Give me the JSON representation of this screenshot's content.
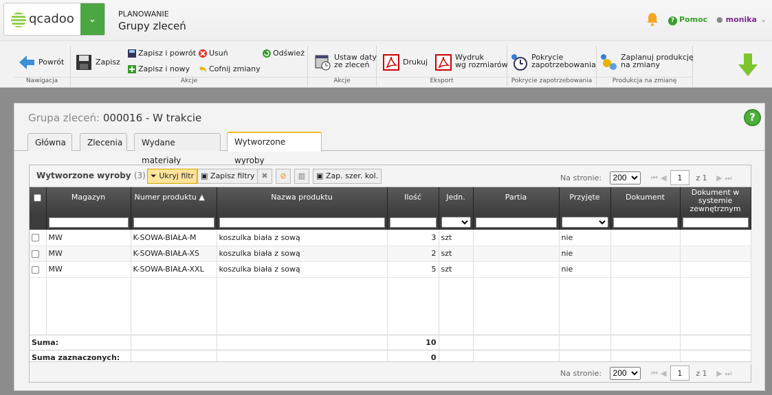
{
  "app": {
    "logo_text": "qcadoo",
    "module": "PLANOWANIE",
    "page": "Grupy zleceń"
  },
  "topnav": {
    "help": "Pomoc",
    "user": "monika"
  },
  "ribbon": {
    "groups": [
      "Nawigacja",
      "Akcje",
      "Akcje",
      "Eksport",
      "Pokrycie zapotrzebowania",
      "Produkcja na zmianę"
    ],
    "back": "Powrót",
    "save": "Zapisz",
    "save_back": "Zapisz i powrót",
    "save_new": "Zapisz i nowy",
    "delete": "Usuń",
    "undo": "Cofnij zmiany",
    "refresh": "Odśwież",
    "set_dates_1": "Ustaw daty",
    "set_dates_2": "ze zleceń",
    "print": "Drukuj",
    "print_sizes_1": "Wydruk",
    "print_sizes_2": "wg rozmiarów",
    "coverage_1": "Pokrycie",
    "coverage_2": "zapotrzebowania",
    "plan_1": "Zaplanuj produkcję",
    "plan_2": "na zmiany"
  },
  "panel": {
    "label": "Grupa zleceń:",
    "value": "000016 - W trakcie"
  },
  "tabs": [
    {
      "label": "Główna"
    },
    {
      "label": "Zlecenia"
    },
    {
      "label": "Wydane materiały"
    },
    {
      "label": "Wytworzone wyroby"
    }
  ],
  "grid": {
    "title": "Wytworzone wyroby",
    "count": "(3)",
    "buttons": {
      "hide_filter": "Ukryj filtr",
      "save_filters": "Zapisz filtry",
      "save_widths": "Zap. szer. kol."
    },
    "pager": {
      "label": "Na stronie:",
      "per_page": "200",
      "page": "1",
      "of": "z 1"
    },
    "columns": [
      "Magazyn",
      "Numer produktu",
      "Nazwa produktu",
      "Ilość",
      "Jedn.",
      "Partia",
      "Przyjęte",
      "Dokument",
      "Dokument w systemie zewnętrznym"
    ],
    "rows": [
      {
        "magazyn": "MW",
        "numer": "K-SOWA-BIAŁA-M",
        "nazwa": "koszulka biała z sową",
        "ilosc": "3",
        "jedn": "szt",
        "partia": "",
        "przyjete": "nie",
        "dokument": "",
        "dok_zew": ""
      },
      {
        "magazyn": "MW",
        "numer": "K-SOWA-BIAŁA-XS",
        "nazwa": "koszulka biała z sową",
        "ilosc": "2",
        "jedn": "szt",
        "partia": "",
        "przyjete": "nie",
        "dokument": "",
        "dok_zew": ""
      },
      {
        "magazyn": "MW",
        "numer": "K-SOWA-BIAŁA-XXL",
        "nazwa": "koszulka biała z sową",
        "ilosc": "5",
        "jedn": "szt",
        "partia": "",
        "przyjete": "nie",
        "dokument": "",
        "dok_zew": ""
      }
    ],
    "sum_label": "Suma:",
    "sum_value": "10",
    "sum_selected_label": "Suma zaznaczonych:",
    "sum_selected_value": "0"
  },
  "colors": {
    "accent_green": "#4aa742",
    "active_tab": "#f0c020",
    "filter_on": "#ffe49a"
  }
}
